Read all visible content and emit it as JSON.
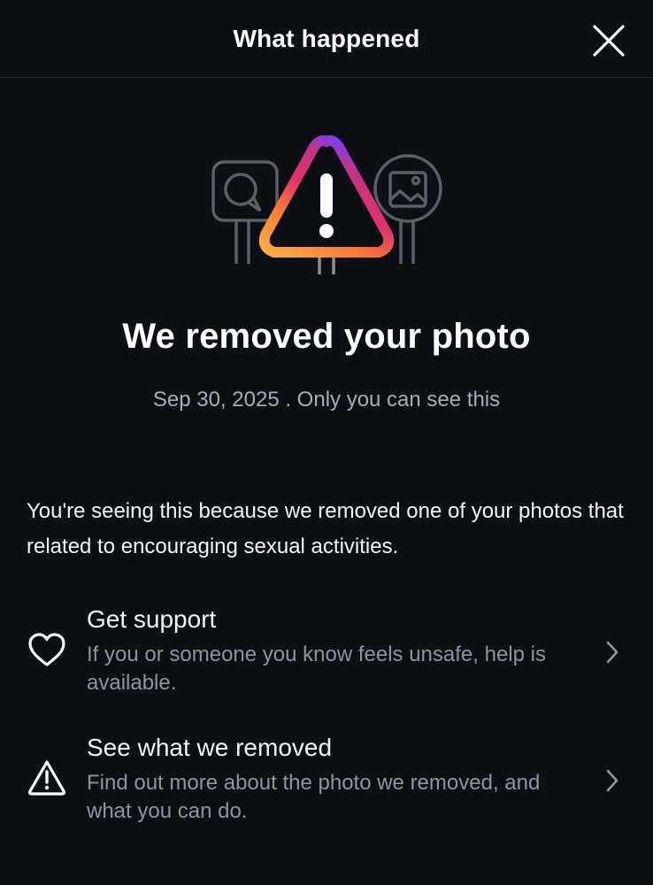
{
  "header": {
    "title": "What happened"
  },
  "icons": {
    "close": "close-icon",
    "hero": "warning-illustration",
    "support": "heart-icon",
    "removed": "warning-triangle-icon",
    "chevron": "chevron-right-icon"
  },
  "colors": {
    "background": "#0c1014",
    "gradient": [
      "#7a3ff2",
      "#e1306c",
      "#fd1d1d",
      "#f77737",
      "#fcaf45"
    ],
    "muted_text": "#8e949b"
  },
  "main": {
    "title": "We removed your photo",
    "subtitle": "Sep 30, 2025 . Only you can see this",
    "body": "You're seeing this because we removed one of your photos that related to encouraging sexual activities."
  },
  "actions": [
    {
      "title": "Get support",
      "description": "If you or someone you know feels unsafe, help is available."
    },
    {
      "title": "See what we removed",
      "description": "Find out more about the photo we removed, and what you can do."
    }
  ]
}
